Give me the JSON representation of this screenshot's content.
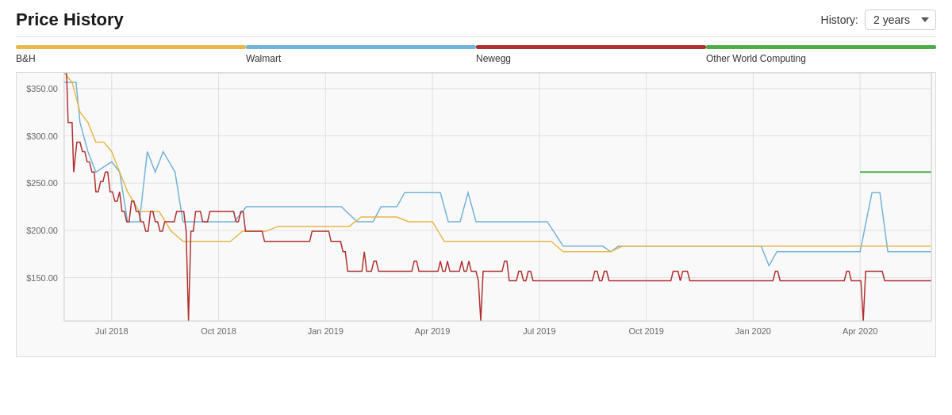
{
  "header": {
    "title": "Price History",
    "history_label": "History:",
    "history_value": "2 years"
  },
  "legend": [
    {
      "name": "B&H",
      "color": "#E8B84B"
    },
    {
      "name": "Walmart",
      "color": "#74B3D8"
    },
    {
      "name": "Newegg",
      "color": "#B03030"
    },
    {
      "name": "Other World Computing",
      "color": "#4BAD4B"
    }
  ],
  "chart": {
    "y_labels": [
      "$350.00",
      "$300.00",
      "$250.00",
      "$200.00",
      "$150.00"
    ],
    "x_labels": [
      "Jul 2018",
      "Oct 2018",
      "Jan 2019",
      "Apr 2019",
      "Jul 2019",
      "Oct 2019",
      "Jan 2020",
      "Apr 2020"
    ]
  }
}
